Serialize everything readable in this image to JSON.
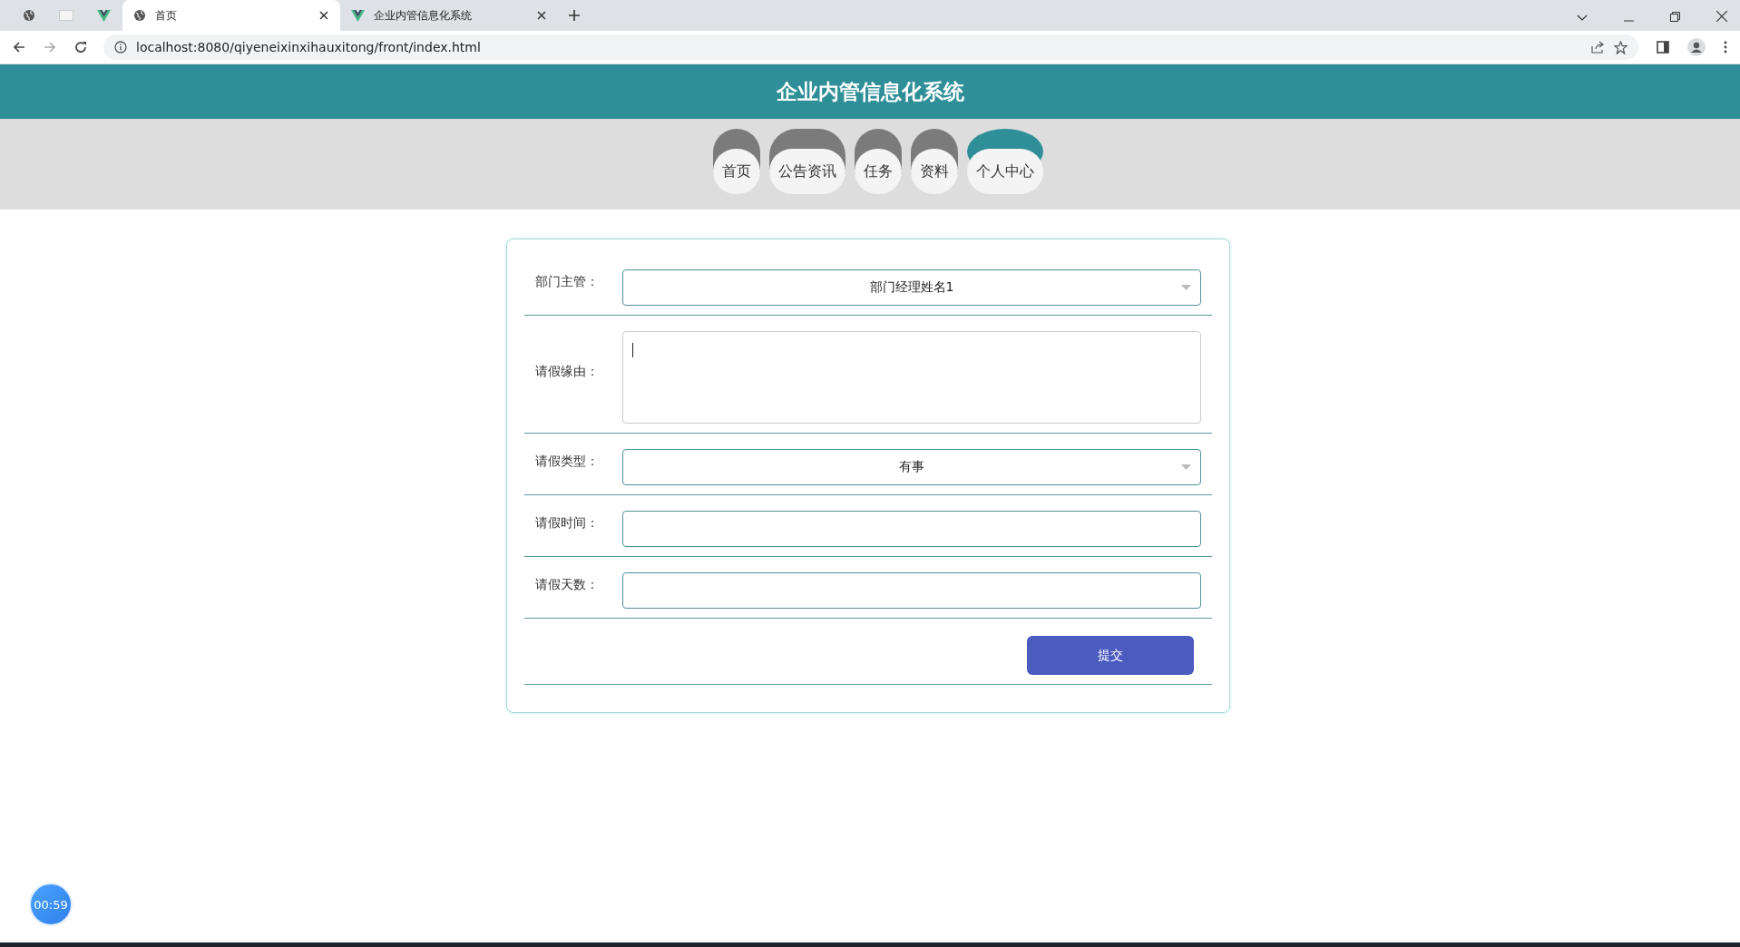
{
  "browser": {
    "tabs": [
      {
        "kind": "globe",
        "selected": false
      },
      {
        "kind": "blank",
        "selected": false
      },
      {
        "kind": "vue",
        "selected": false
      },
      {
        "kind": "globe",
        "title": "首页",
        "selected": true
      },
      {
        "kind": "vue",
        "title": "企业内管信息化系统",
        "selected": false
      }
    ],
    "address": "localhost:8080/qiyeneixinxihauxitong/front/index.html"
  },
  "header": {
    "title": "企业内管信息化系统"
  },
  "nav": [
    {
      "label": "首页",
      "selected": false
    },
    {
      "label": "公告资讯",
      "selected": false
    },
    {
      "label": "任务",
      "selected": false
    },
    {
      "label": "资料",
      "selected": false
    },
    {
      "label": "个人中心",
      "selected": true
    }
  ],
  "form": {
    "fields": [
      {
        "kind": "select",
        "label": "部门主管：",
        "value": "部门经理姓名1"
      },
      {
        "kind": "textarea",
        "label": "请假缘由："
      },
      {
        "kind": "select",
        "label": "请假类型：",
        "value": "有事"
      },
      {
        "kind": "input",
        "label": "请假时间："
      },
      {
        "kind": "input",
        "label": "请假天数："
      }
    ],
    "submit": "提交"
  },
  "timer": "00:59"
}
